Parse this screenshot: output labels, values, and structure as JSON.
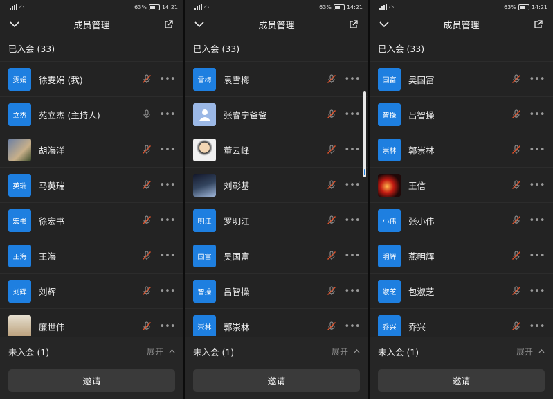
{
  "status": {
    "battery": "63%",
    "time": "14:21"
  },
  "header": {
    "title": "成员管理"
  },
  "joined_label": "已入会 (33)",
  "not_joined_label": "未入会 (1)",
  "expand_label": "展开",
  "invite_label": "邀请",
  "screens": [
    {
      "members": [
        {
          "avatar_text": "雯娟",
          "name": "徐雯娟 (我)",
          "mic": "muted"
        },
        {
          "avatar_text": "立杰",
          "name": "苑立杰 (主持人)",
          "mic": "on"
        },
        {
          "avatar_text": "",
          "name": "胡海洋",
          "mic": "muted",
          "photo": "photo"
        },
        {
          "avatar_text": "英瑞",
          "name": "马英瑞",
          "mic": "muted"
        },
        {
          "avatar_text": "宏书",
          "name": "徐宏书",
          "mic": "muted"
        },
        {
          "avatar_text": "王海",
          "name": "王海",
          "mic": "muted"
        },
        {
          "avatar_text": "刘辉",
          "name": "刘辉",
          "mic": "muted"
        },
        {
          "avatar_text": "",
          "name": "廉世伟",
          "mic": "muted",
          "photo": "photo5"
        }
      ]
    },
    {
      "members": [
        {
          "avatar_text": "雪梅",
          "name": "袁雪梅",
          "mic": "muted"
        },
        {
          "avatar_text": "",
          "name": "张睿宁爸爸",
          "mic": "muted",
          "photo": "ph"
        },
        {
          "avatar_text": "",
          "name": "董云峰",
          "mic": "muted",
          "photo": "photo6"
        },
        {
          "avatar_text": "",
          "name": "刘彰基",
          "mic": "muted",
          "photo": "photo3"
        },
        {
          "avatar_text": "明江",
          "name": "罗明江",
          "mic": "muted"
        },
        {
          "avatar_text": "国富",
          "name": "吴国富",
          "mic": "muted"
        },
        {
          "avatar_text": "智操",
          "name": "吕智操",
          "mic": "muted"
        },
        {
          "avatar_text": "崇林",
          "name": "郭崇林",
          "mic": "muted"
        }
      ]
    },
    {
      "members": [
        {
          "avatar_text": "国富",
          "name": "吴国富",
          "mic": "muted"
        },
        {
          "avatar_text": "智操",
          "name": "吕智操",
          "mic": "muted"
        },
        {
          "avatar_text": "崇林",
          "name": "郭崇林",
          "mic": "muted"
        },
        {
          "avatar_text": "",
          "name": "王信",
          "mic": "muted",
          "photo": "photo4"
        },
        {
          "avatar_text": "小伟",
          "name": "张小伟",
          "mic": "muted"
        },
        {
          "avatar_text": "明辉",
          "name": "燕明辉",
          "mic": "muted"
        },
        {
          "avatar_text": "淑芝",
          "name": "包淑芝",
          "mic": "muted"
        },
        {
          "avatar_text": "乔兴",
          "name": "乔兴",
          "mic": "muted"
        }
      ]
    }
  ]
}
